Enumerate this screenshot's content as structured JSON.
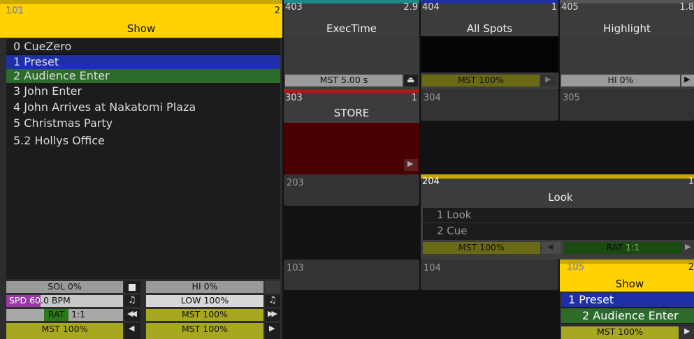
{
  "colors": {
    "yellow": "#ffd200",
    "blue": "#1f2fa8",
    "green": "#2c6b2a",
    "red_bg": "#4a0000",
    "olive": "#8a8a18",
    "purple": "#9a3aa4",
    "teal": "#1a8a8a"
  },
  "exec101": {
    "number": "101",
    "page": "2",
    "title": "Show",
    "cues": [
      {
        "label": "0 CueZero"
      },
      {
        "label": "1 Preset"
      },
      {
        "label": "2 Audience Enter"
      },
      {
        "label": "3 John Enter"
      },
      {
        "label": "4 John Arrives at Nakatomi Plaza"
      },
      {
        "label": "5 Christmas Party"
      },
      {
        "label": "5.2 Hollys Office"
      }
    ],
    "faders": {
      "sol": "SOL 0%",
      "hi": "HI  0%",
      "spd_key": "SPD 60",
      "spd_rest": ".0 BPM",
      "low": "LOW 100%",
      "rat_key": "RAT",
      "rat_rest": " 1:1",
      "mst_mid": "MST 100%",
      "mst_left": "MST 100%",
      "mst_right": "MST 100%"
    }
  },
  "exec403": {
    "number": "403",
    "value": "2.9",
    "title": "ExecTime",
    "fader": "MST 5.00 s"
  },
  "exec404": {
    "number": "404",
    "value": "1",
    "title": "All Spots",
    "fader": "MST 100%"
  },
  "exec405": {
    "number": "405",
    "value": "1.8",
    "title": "Highlight",
    "fader": "HI  0%"
  },
  "exec303": {
    "number": "303",
    "value": "1",
    "title": "STORE"
  },
  "exec304": {
    "number": "304"
  },
  "exec305": {
    "number": "305"
  },
  "exec203": {
    "number": "203"
  },
  "exec204": {
    "number": "204",
    "value": "1",
    "title": "Look",
    "items": [
      "1 Look",
      "2 Cue"
    ],
    "fader_mst": "MST 100%",
    "fader_rat_key": "RAT",
    "fader_rat_rest": " 1:1"
  },
  "exec103": {
    "number": "103"
  },
  "exec104": {
    "number": "104"
  },
  "exec105": {
    "number": "105",
    "value": "2",
    "title": "Show",
    "items": [
      "1 Preset",
      "2 Audience Enter"
    ],
    "fader": "MST 100%"
  }
}
